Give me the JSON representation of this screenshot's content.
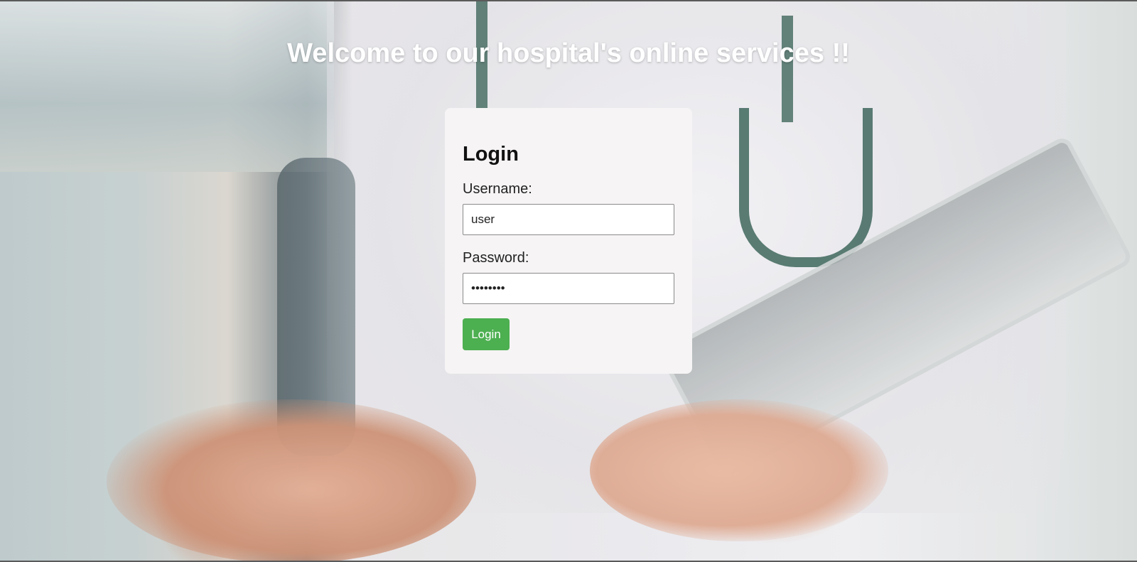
{
  "page": {
    "heading": "Welcome to our hospital's online services !!"
  },
  "login_form": {
    "title": "Login",
    "username_label": "Username:",
    "username_value": "user",
    "password_label": "Password:",
    "password_value": "password",
    "submit_label": "Login"
  },
  "colors": {
    "button_bg": "#4caf50",
    "card_bg": "#f6f4f5",
    "heading_text": "#ffffff"
  }
}
